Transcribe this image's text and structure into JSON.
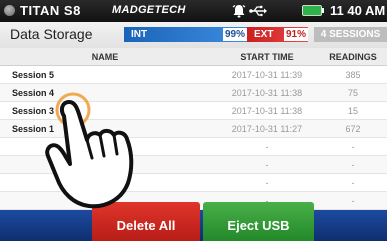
{
  "status_bar": {
    "device_name": "TITAN S8",
    "manufacturer": "MADGETECH",
    "time": "11 40 AM",
    "icons": [
      "logo-dot-icon",
      "alarm-icon",
      "usb-icon",
      "battery-icon"
    ],
    "battery_color": "#2db34a"
  },
  "header": {
    "title": "Data Storage",
    "internal_memory": {
      "label": "INT",
      "percent": "99%",
      "fill": 0.99,
      "color": "#2a74cc"
    },
    "external_memory": {
      "label": "EXT",
      "percent": "91%",
      "fill": 0.91,
      "color": "#d62f2f"
    },
    "sessions_label": "4 SESSIONS"
  },
  "table": {
    "columns": [
      "NAME",
      "START TIME",
      "READINGS"
    ],
    "rows": [
      {
        "name": "Session 5",
        "start": "2017-10-31 11:39",
        "readings": "385"
      },
      {
        "name": "Session 4",
        "start": "2017-10-31 11:38",
        "readings": "75"
      },
      {
        "name": "Session 3",
        "start": "2017-10-31 11:38",
        "readings": "15"
      },
      {
        "name": "Session 1",
        "start": "2017-10-31 11:27",
        "readings": "672"
      },
      {
        "name": "",
        "start": "-",
        "readings": "-"
      },
      {
        "name": "",
        "start": "-",
        "readings": "-"
      },
      {
        "name": "",
        "start": "-",
        "readings": "-"
      },
      {
        "name": "",
        "start": "-",
        "readings": "-"
      }
    ]
  },
  "footer": {
    "delete_all_label": "Delete All",
    "eject_usb_label": "Eject USB",
    "delete_color": "#d42a22",
    "eject_color": "#3aa53c",
    "bar_color": "#163d86"
  },
  "overlay": {
    "icon": "pointing-hand-icon",
    "touch_target": "Session 3"
  }
}
